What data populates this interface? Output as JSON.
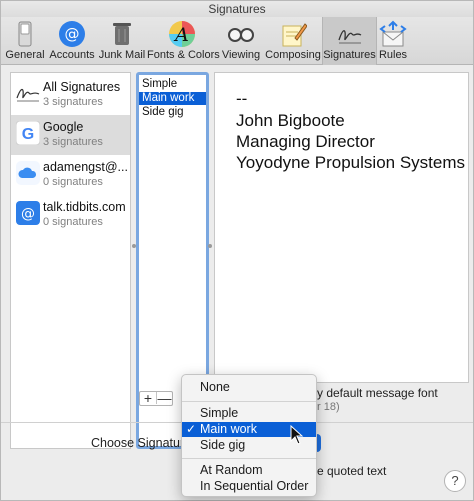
{
  "window": {
    "title": "Signatures"
  },
  "toolbar": {
    "items": [
      {
        "label": "General",
        "icon": "switch-icon"
      },
      {
        "label": "Accounts",
        "icon": "at-sign-icon"
      },
      {
        "label": "Junk Mail",
        "icon": "trash-icon"
      },
      {
        "label": "Fonts & Colors",
        "icon": "font-palette-icon"
      },
      {
        "label": "Viewing",
        "icon": "glasses-icon"
      },
      {
        "label": "Composing",
        "icon": "pencil-note-icon"
      },
      {
        "label": "Signatures",
        "icon": "signature-icon",
        "active": true
      },
      {
        "label": "Rules",
        "icon": "envelope-arrows-icon"
      }
    ]
  },
  "accounts": [
    {
      "name": "All Signatures",
      "count": "3 signatures",
      "icon": "signature-icon"
    },
    {
      "name": "Google",
      "count": "3 signatures",
      "icon": "google-icon",
      "selected": true
    },
    {
      "name": "adamengst@...",
      "count": "0 signatures",
      "icon": "icloud-icon"
    },
    {
      "name": "talk.tidbits.com",
      "count": "0 signatures",
      "icon": "at-sign-icon"
    }
  ],
  "signatures": [
    {
      "name": "Simple"
    },
    {
      "name": "Main work",
      "selected": true
    },
    {
      "name": "Side gig"
    }
  ],
  "preview": {
    "lines": [
      "--",
      "John Bigboote",
      "Managing Director",
      "Yoyodyne Propulsion Systems"
    ]
  },
  "options": {
    "font_text": "y default message font",
    "font_sub": "r 18)",
    "choose_label": "Choose Signature",
    "quoted_text": "e quoted text"
  },
  "menu": {
    "items": [
      "None",
      "Simple",
      "Main work",
      "Side gig",
      "At Random",
      "In Sequential Order"
    ],
    "selected": "Main work"
  },
  "controls": {
    "add": "+",
    "remove": "—",
    "help": "?"
  },
  "colors": {
    "selection": "#0a5fd6",
    "focus_ring": "#7aa7e0"
  }
}
